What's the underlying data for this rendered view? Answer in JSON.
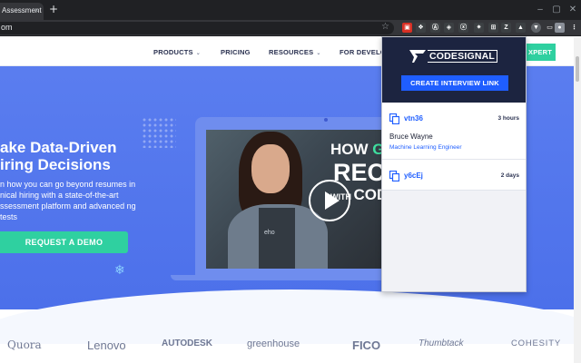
{
  "browser": {
    "tab_title": "Assessment",
    "tab_close": "×",
    "new_tab": "+",
    "url": "om",
    "star_icon": "☆",
    "window_controls": [
      "–",
      "▢",
      "✕"
    ],
    "extensions": [
      {
        "name": "red-extension-icon",
        "color": "#d93025",
        "glyph": "▣"
      },
      {
        "name": "dots-extension-icon",
        "color": "#3c4043",
        "glyph": "❖"
      },
      {
        "name": "circle-a-extension-icon",
        "color": "#3c4043",
        "glyph": "Ⓐ"
      },
      {
        "name": "puzzle-extension-icon",
        "color": "#3c4043",
        "glyph": "◈"
      },
      {
        "name": "x-extension-icon",
        "color": "#3c4043",
        "glyph": "ⓧ"
      },
      {
        "name": "star-extension-icon",
        "color": "#3c4043",
        "glyph": "✷"
      },
      {
        "name": "grid-extension-icon",
        "color": "#3c4043",
        "glyph": "⊞"
      },
      {
        "name": "z-extension-icon",
        "color": "#3c4043",
        "glyph": "Z"
      },
      {
        "name": "triangle-extension-icon",
        "color": "#3c4043",
        "glyph": "▲"
      },
      {
        "name": "codesignal-extension-icon",
        "color": "#5f6368",
        "glyph": "▼"
      },
      {
        "name": "cast-icon",
        "color": "#35363a",
        "glyph": "▭"
      },
      {
        "name": "profile-avatar",
        "color": "#8a8f98",
        "glyph": "●"
      },
      {
        "name": "menu-icon",
        "color": "#35363a",
        "glyph": "⋮"
      }
    ]
  },
  "nav": {
    "items": [
      {
        "label": "PRODUCTS",
        "dropdown": true
      },
      {
        "label": "PRICING",
        "dropdown": false
      },
      {
        "label": "RESOURCES",
        "dropdown": true
      },
      {
        "label": "FOR DEVELO",
        "dropdown": false
      }
    ],
    "chevron": "⌄",
    "cut_button_label": "XPERT"
  },
  "hero": {
    "headline_line1": "ake Data-Driven",
    "headline_line2": "iring Decisions",
    "subtext": "n how you can go beyond resumes in nical hiring with a state-of-the-art ssessment platform and advanced ng tests",
    "cta_label": "REQUEST A DEMO",
    "snowflake": "❄"
  },
  "video": {
    "line1_prefix": "HOW ",
    "line1_highlight": "GRE",
    "line2": "REC",
    "line3_prefix": "WITH ",
    "line3_rest": "COD",
    "shirt_text": "eho"
  },
  "logos": [
    "Quora",
    "Lenovo",
    "AUTODESK",
    "greenhouse",
    "FICO",
    "Thumbtack",
    "COHESITY"
  ],
  "popup": {
    "brand": "CODESIGNAL",
    "create_button": "CREATE INTERVIEW LINK",
    "links": [
      {
        "code": "vtn36",
        "age": "3 hours",
        "candidate": "Bruce Wayne",
        "role": "Machine Learning Engineer"
      },
      {
        "code": "y6cEj",
        "age": "2 days"
      }
    ]
  },
  "colors": {
    "accent": "#1f5eff",
    "cta": "#2fd0a0",
    "hero": "#5c7ff0",
    "popup_header": "#1c2440"
  }
}
